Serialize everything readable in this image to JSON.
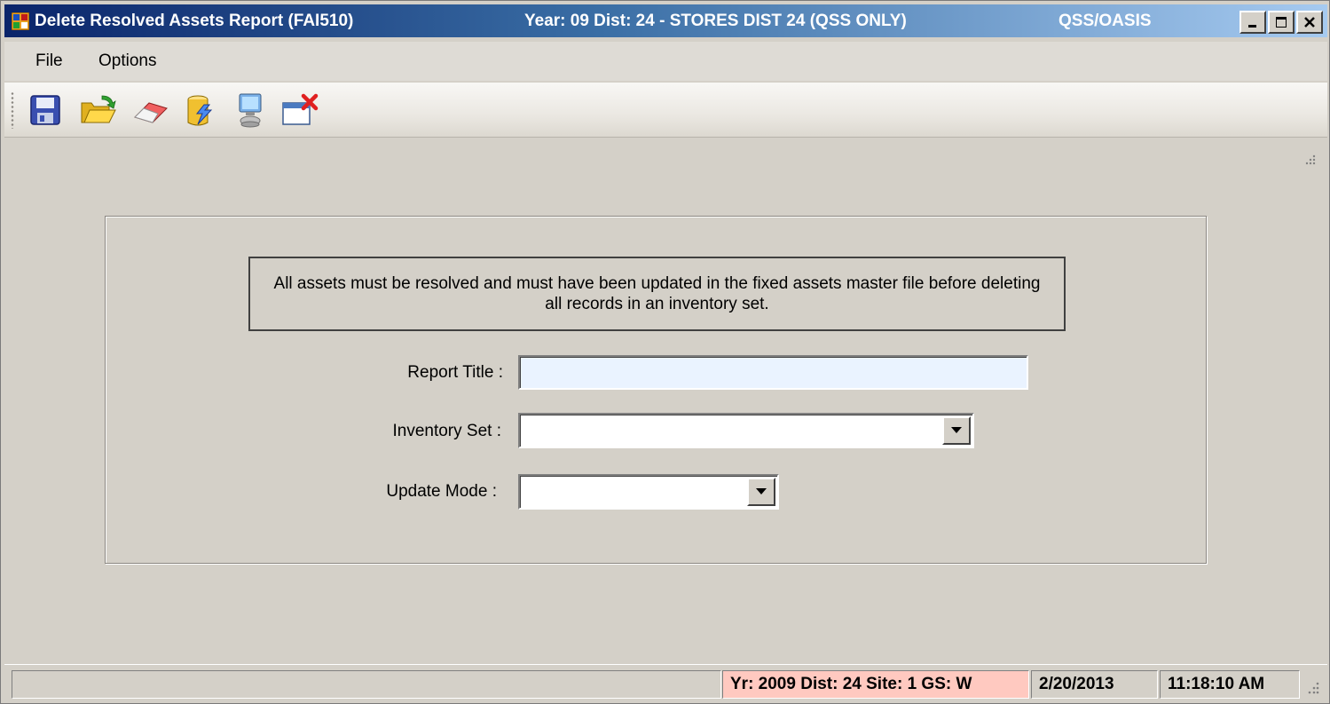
{
  "window": {
    "title": "Delete Resolved Assets Report (FAI510)",
    "context": "Year: 09 Dist: 24 - STORES DIST 24 (QSS ONLY)",
    "app": "QSS/OASIS"
  },
  "menu": {
    "file": "File",
    "options": "Options"
  },
  "toolbar": {
    "buttons": [
      {
        "icon": "save-icon"
      },
      {
        "icon": "open-folder-icon"
      },
      {
        "icon": "eraser-icon"
      },
      {
        "icon": "run-batch-icon"
      },
      {
        "icon": "computer-icon"
      },
      {
        "icon": "close-window-icon"
      }
    ]
  },
  "form": {
    "notice": "All assets must be resolved and must have been updated in the fixed assets master file before deleting all records in an inventory set.",
    "report_title_label": "Report Title :",
    "report_title_value": "",
    "inventory_set_label": "Inventory Set :",
    "inventory_set_value": "",
    "update_mode_label": "Update Mode :",
    "update_mode_value": ""
  },
  "status": {
    "site": "Yr: 2009 Dist: 24 Site: 1 GS: W",
    "date": "2/20/2013",
    "time": "11:18:10 AM"
  },
  "colors": {
    "title_start": "#0a246a",
    "title_end": "#a6caf0",
    "site_panel": "#ffc9c0",
    "textbox_bg": "#eaf3ff"
  }
}
